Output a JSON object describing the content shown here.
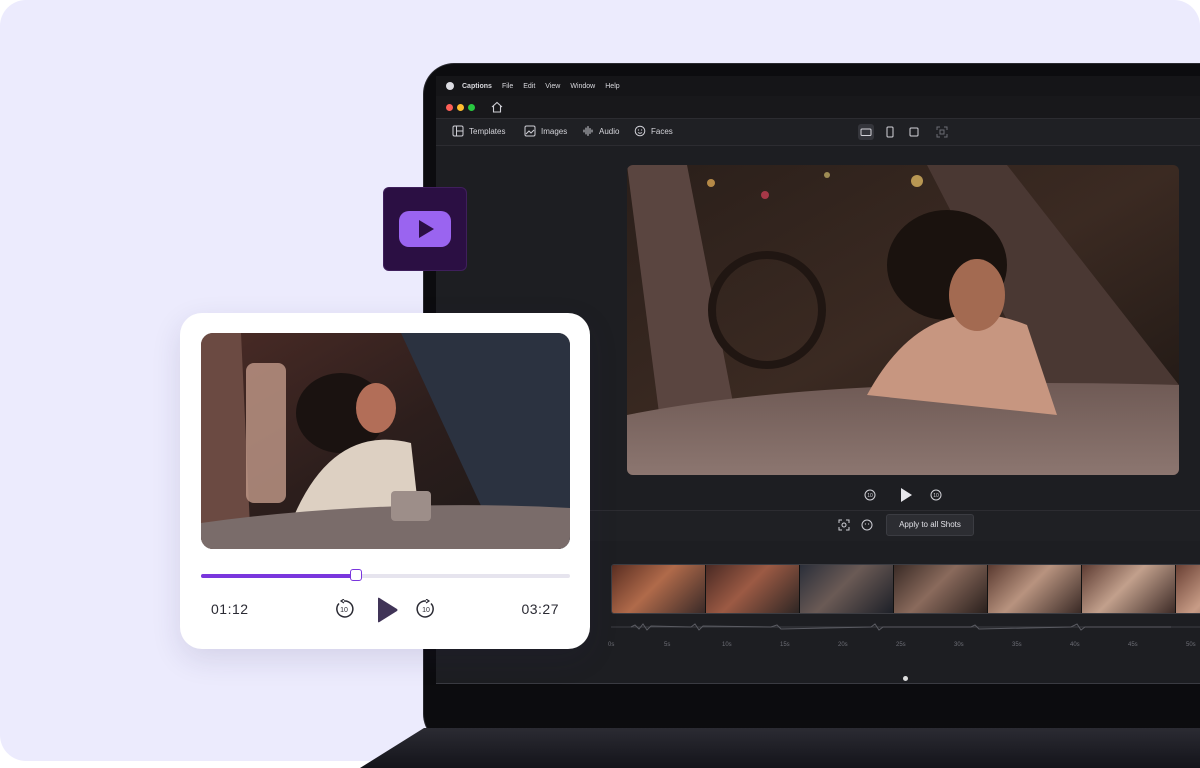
{
  "app": {
    "name": "Captions",
    "menu": [
      "File",
      "Edit",
      "View",
      "Window",
      "Help"
    ]
  },
  "toolbar": {
    "items": [
      {
        "label": "Templates",
        "icon": "templates-icon"
      },
      {
        "label": "Images",
        "icon": "images-icon"
      },
      {
        "label": "Audio",
        "icon": "audio-icon"
      },
      {
        "label": "Faces",
        "icon": "faces-icon"
      }
    ]
  },
  "timeline": {
    "apply_label": "Apply to all Shots",
    "ruler_ticks": [
      "0s",
      "5s",
      "10s",
      "15s",
      "20s",
      "25s",
      "30s",
      "35s",
      "40s",
      "45s",
      "50s"
    ]
  },
  "player": {
    "current_time": "01:12",
    "total_time": "03:27",
    "progress": 0.42,
    "skip_seconds": "10"
  },
  "colors": {
    "accent": "#7a36dd",
    "youtube_tile": "#2b0f43",
    "background": "#ecebfd"
  }
}
